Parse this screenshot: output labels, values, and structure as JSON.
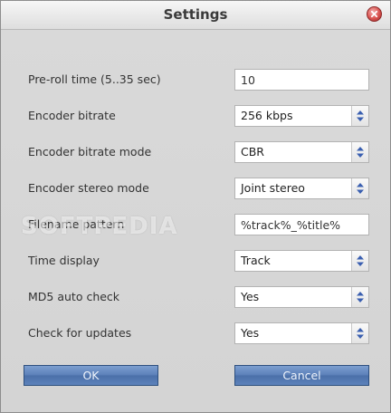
{
  "dialog": {
    "title": "Settings",
    "watermark": "SOFTPEDIA"
  },
  "fields": [
    {
      "label": "Pre-roll time (5..35 sec)",
      "type": "input",
      "value": "10"
    },
    {
      "label": "Encoder bitrate",
      "type": "select",
      "value": "256 kbps"
    },
    {
      "label": "Encoder bitrate mode",
      "type": "select",
      "value": "CBR"
    },
    {
      "label": "Encoder stereo mode",
      "type": "select",
      "value": "Joint stereo"
    },
    {
      "label": "Filename pattern",
      "type": "input",
      "value": "%track%_%title%"
    },
    {
      "label": "Time display",
      "type": "select",
      "value": "Track"
    },
    {
      "label": "MD5 auto check",
      "type": "select",
      "value": "Yes"
    },
    {
      "label": "Check for updates",
      "type": "select",
      "value": "Yes"
    }
  ],
  "buttons": {
    "ok": "OK",
    "cancel": "Cancel"
  },
  "colors": {
    "button": "#5a7fb8",
    "arrow": "#3a5fb0"
  }
}
